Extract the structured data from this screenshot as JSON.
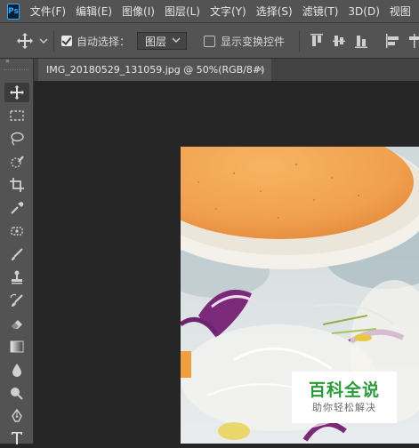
{
  "app": {
    "logo": "Ps"
  },
  "menu": {
    "items": [
      "文件(F)",
      "编辑(E)",
      "图像(I)",
      "图层(L)",
      "文字(Y)",
      "选择(S)",
      "滤镜(T)",
      "3D(D)",
      "视图"
    ]
  },
  "options": {
    "auto_select_label": "自动选择：",
    "auto_select_checked": true,
    "target_value": "图层",
    "show_transform_label": "显示变换控件",
    "show_transform_checked": false
  },
  "document": {
    "tab_title": "IMG_20180529_131059.jpg @ 50%(RGB/8#)",
    "close_glyph": "×"
  },
  "toolbar": {
    "collapse_glyph": "»",
    "tools": [
      "move-tool",
      "marquee-tool",
      "lasso-tool",
      "quick-selection-tool",
      "crop-tool",
      "eyedropper-tool",
      "healing-brush-tool",
      "brush-tool",
      "clone-stamp-tool",
      "history-brush-tool",
      "eraser-tool",
      "gradient-tool",
      "blur-tool",
      "dodge-tool",
      "pen-tool",
      "type-tool"
    ]
  },
  "watermark": {
    "title": "百科全说",
    "subtitle": "助你轻松解决"
  },
  "colors": {
    "ui_dark": "#262626",
    "panel": "#535353",
    "watermark_green": "#2a9a3a"
  }
}
